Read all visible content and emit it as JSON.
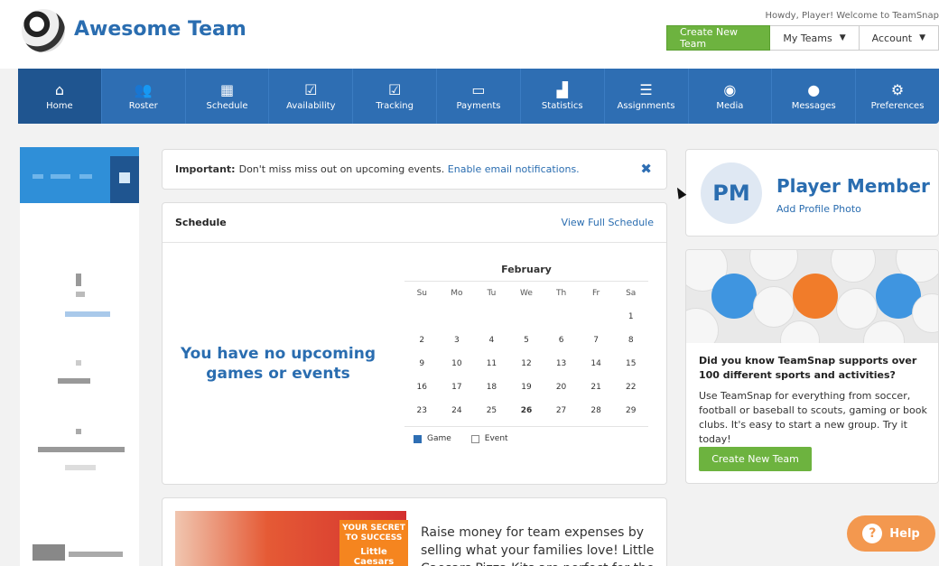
{
  "header": {
    "team_name": "Awesome Team",
    "greeting": "Howdy, Player! Welcome to TeamSnap",
    "create_team_label": "Create New Team",
    "my_teams_label": "My Teams",
    "account_label": "Account"
  },
  "nav": {
    "items": [
      {
        "label": "Home",
        "icon": "home-icon"
      },
      {
        "label": "Roster",
        "icon": "roster-icon"
      },
      {
        "label": "Schedule",
        "icon": "calendar-icon"
      },
      {
        "label": "Availability",
        "icon": "availability-icon"
      },
      {
        "label": "Tracking",
        "icon": "tracking-icon"
      },
      {
        "label": "Payments",
        "icon": "payments-icon"
      },
      {
        "label": "Statistics",
        "icon": "statistics-icon"
      },
      {
        "label": "Assignments",
        "icon": "assignments-icon"
      },
      {
        "label": "Media",
        "icon": "camera-icon"
      },
      {
        "label": "Messages",
        "icon": "messages-icon"
      },
      {
        "label": "Preferences",
        "icon": "gear-icon"
      }
    ]
  },
  "alert": {
    "bold_label": "Important:",
    "text": "Don't miss miss out on upcoming events.",
    "link": "Enable email notifications."
  },
  "schedule": {
    "title": "Schedule",
    "view_full_label": "View Full Schedule",
    "empty_message": "You have no upcoming games or events",
    "month": "February",
    "day_headers": [
      "Su",
      "Mo",
      "Tu",
      "We",
      "Th",
      "Fr",
      "Sa"
    ],
    "weeks": [
      [
        "",
        "",
        "",
        "",
        "",
        "",
        "1"
      ],
      [
        "2",
        "3",
        "4",
        "5",
        "6",
        "7",
        "8"
      ],
      [
        "9",
        "10",
        "11",
        "12",
        "13",
        "14",
        "15"
      ],
      [
        "16",
        "17",
        "18",
        "19",
        "20",
        "21",
        "22"
      ],
      [
        "23",
        "24",
        "25",
        "26",
        "27",
        "28",
        "29"
      ]
    ],
    "legend_game": "Game",
    "legend_event": "Event"
  },
  "promo": {
    "badge_line1": "YOUR SECRET",
    "badge_line2": "TO SUCCESS",
    "badge_brand": "Little Caesars",
    "text": "Raise money for team expenses by selling what your families love! Little Caesars Pizza Kits are perfect for the"
  },
  "profile": {
    "initials": "PM",
    "name": "Player Member",
    "add_photo_label": "Add Profile Photo"
  },
  "sports": {
    "title": "Did you know TeamSnap supports over 100 different sports and activities?",
    "body": "Use TeamSnap for everything from soccer, football or baseball to scouts, gaming or book clubs. It's easy to start a new group. Try it today!",
    "button_label": "Create New Team"
  },
  "help": {
    "label": "Help"
  }
}
